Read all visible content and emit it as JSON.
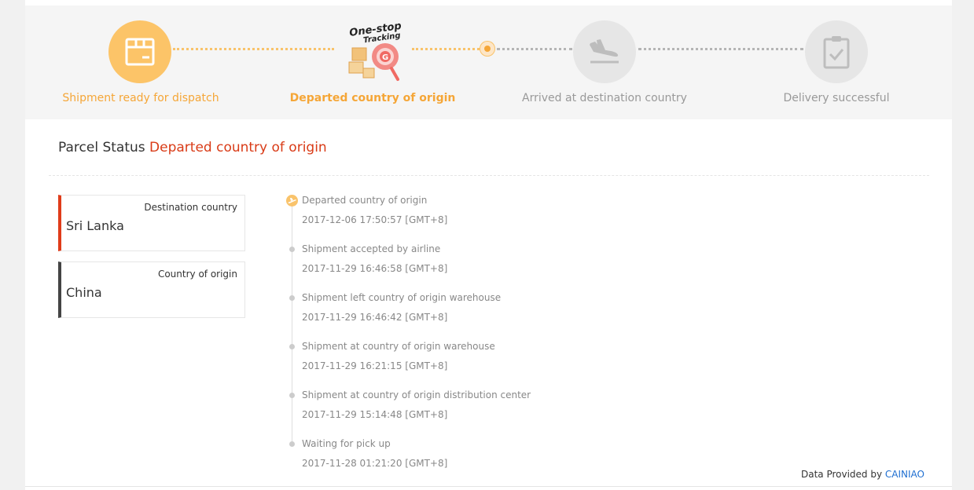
{
  "tracking_badge": {
    "line1": "One-stop",
    "line2": "Tracking"
  },
  "steps": [
    {
      "label": "Shipment ready for dispatch",
      "icon": "box-icon",
      "state": "done"
    },
    {
      "label": "Departed country of origin",
      "icon": "one-stop-tracking-badge",
      "state": "current"
    },
    {
      "label": "Arrived at destination country",
      "icon": "plane-landing-icon",
      "state": "pending"
    },
    {
      "label": "Delivery successful",
      "icon": "clipboard-check-icon",
      "state": "pending"
    }
  ],
  "parcel_status": {
    "label": "Parcel Status",
    "value": "Departed country of origin"
  },
  "destination": {
    "label": "Destination country",
    "value": "Sri Lanka",
    "accent": "#e03c1a"
  },
  "origin": {
    "label": "Country of origin",
    "value": "China",
    "accent": "#444444"
  },
  "events": [
    {
      "title": "Departed country of origin",
      "time": "2017-12-06 17:50:57 [GMT+8]"
    },
    {
      "title": "Shipment accepted by airline",
      "time": "2017-11-29 16:46:58 [GMT+8]"
    },
    {
      "title": "Shipment left country of origin warehouse",
      "time": "2017-11-29 16:46:42 [GMT+8]"
    },
    {
      "title": "Shipment at country of origin warehouse",
      "time": "2017-11-29 16:21:15 [GMT+8]"
    },
    {
      "title": "Shipment at country of origin distribution center",
      "time": "2017-11-29 15:14:48 [GMT+8]"
    },
    {
      "title": "Waiting for pick up",
      "time": "2017-11-28 01:21:20 [GMT+8]"
    }
  ],
  "footer": {
    "prefix": "Data Provided by",
    "provider": "CAINIAO"
  },
  "colors": {
    "orange": "#f5a637",
    "status_red": "#d93b17",
    "link_blue": "#1f6fd1"
  }
}
